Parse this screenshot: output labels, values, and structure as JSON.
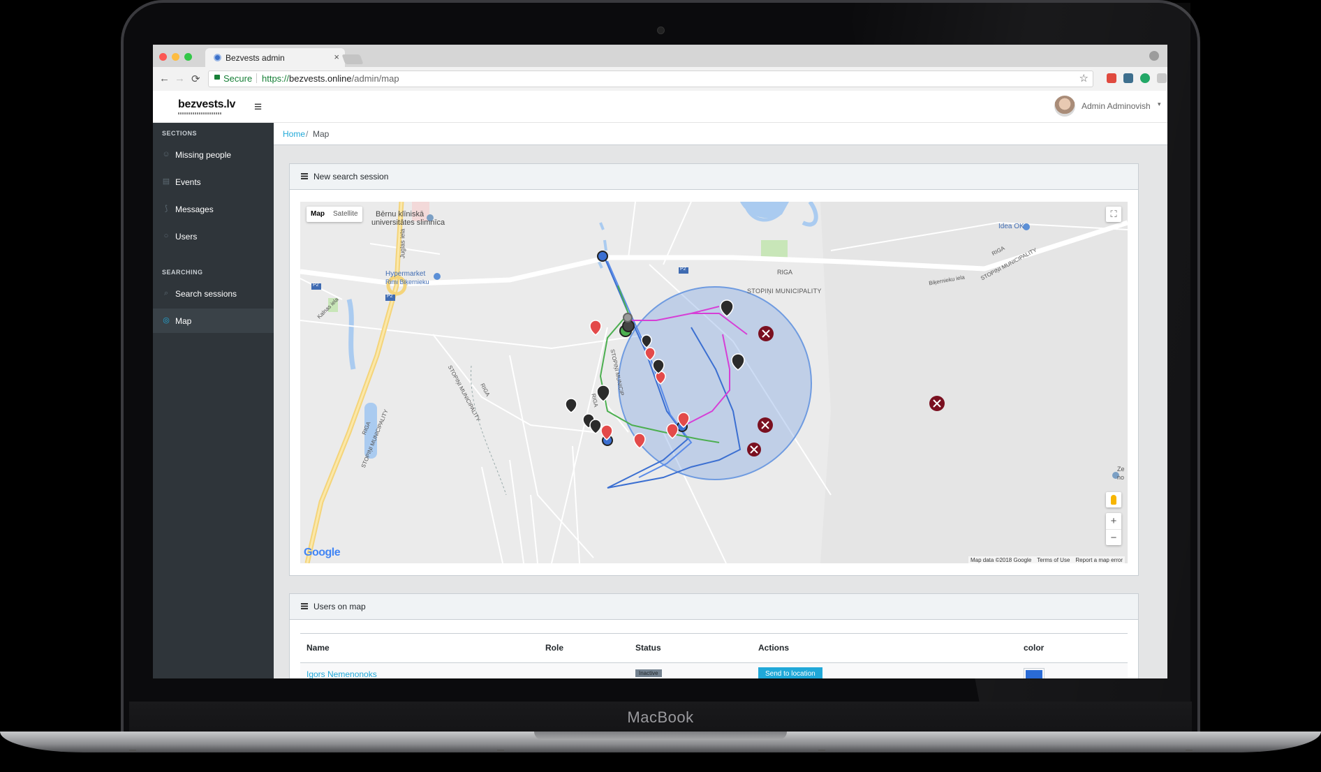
{
  "device": {
    "brand": "MacBook"
  },
  "browser": {
    "tab_title": "Bezvests admin",
    "tab_close": "×",
    "secure_label": "Secure",
    "url_scheme": "https://",
    "url_host": "bezvests.online",
    "url_path": "/admin/map",
    "nav": {
      "back": "←",
      "forward": "→",
      "reload": "⟳"
    },
    "star": "☆"
  },
  "header": {
    "logo": "bezvests.lv",
    "menu_icon": "≡",
    "user_name": "Admin Adminovish",
    "caret": "▾"
  },
  "sidebar": {
    "sections_title": "SECTIONS",
    "searching_title": "SEARCHING",
    "items": [
      {
        "label": "Missing people",
        "icon": "user-icon",
        "glyph": "☺"
      },
      {
        "label": "Events",
        "icon": "calendar-icon",
        "glyph": "▤"
      },
      {
        "label": "Messages",
        "icon": "rss-icon",
        "glyph": "⟆"
      },
      {
        "label": "Users",
        "icon": "users-icon",
        "glyph": "○"
      },
      {
        "label": "Search sessions",
        "icon": "search-icon",
        "glyph": "⌕"
      },
      {
        "label": "Map",
        "icon": "compass-icon",
        "glyph": "◎",
        "active": true
      }
    ]
  },
  "breadcrumb": {
    "home": "Home",
    "separator": "/",
    "current": "Map"
  },
  "map_card": {
    "title": "New search session",
    "map_type": {
      "map": "Map",
      "satellite": "Satellite"
    },
    "fullscreen": "⛶",
    "zoom_in": "+",
    "zoom_out": "−",
    "google": "Google",
    "attribution": {
      "data": "Map data ©2018 Google",
      "terms": "Terms of Use",
      "report": "Report a map error"
    },
    "labels": {
      "hospital": "Bērnu klīniskā",
      "hospital2": "universitātes slimnīca",
      "hypermarket": "Hypermarket",
      "hypermarket2": "Rimi Biķernieku",
      "juglas": "Juglas iela",
      "p2a": "P2",
      "p2b": "P2",
      "p2c": "P2",
      "riga_top": "RIGA",
      "stopini_top": "STOPIŅI MUNICIPALITY",
      "bikernieku": "Biķernieku iela",
      "idea": "Idea OK",
      "riga_right": "RIGA",
      "stopini_right": "STOPIŅI MUNICIPALITY",
      "kalnas": "Kalnas iela",
      "riga_left": "RIGA",
      "stopini_left": "STOPIŅI MUNICIPALITY",
      "riga_mid": "RIGA",
      "stopini_mid": "STOPIŅI MUNICIPALITY",
      "riga_sw": "RIGA",
      "stopini_sw": "STOPIŅI MUNICIPALITY",
      "stopini_c": "STOPIŅI MUNICIP",
      "riga_c": "RIGA",
      "ze": "Ze",
      "no": "no"
    },
    "colors": {
      "circle": "#6f9be0",
      "track_blue": "#3b6fd1",
      "track_green": "#4caf50",
      "track_magenta": "#d63fd6",
      "marker_red": "#e34a4a",
      "marker_dark": "#7a1020"
    }
  },
  "users_card": {
    "title": "Users on map",
    "columns": [
      "Name",
      "Role",
      "Status",
      "Actions",
      "color"
    ],
    "rows": [
      {
        "name": "Igors Nemenonoks",
        "role": "",
        "status": "Inactive",
        "action": "Send to location",
        "color": "#2a6bd6"
      }
    ]
  }
}
